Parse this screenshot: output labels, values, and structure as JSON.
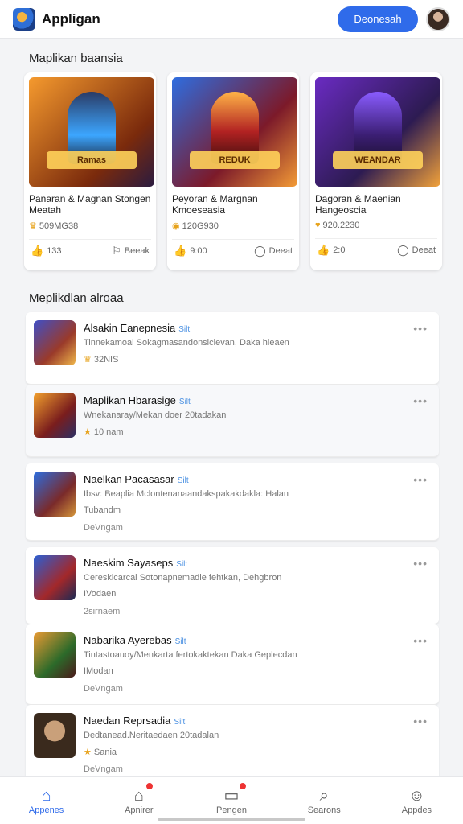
{
  "header": {
    "title": "Appligan",
    "button_label": "Deonesah",
    "logo_icon": "app-logo-icon",
    "avatar_icon": "user-avatar-icon"
  },
  "featured": {
    "title": "Maplikan baansia",
    "cards": [
      {
        "title": "Panaran & Magnan Stongen Meatah",
        "meta": "509MG38",
        "likes": "133",
        "action": "Beeak",
        "banner": "Ramas"
      },
      {
        "title": "Peyoran & Margnan Kmoeseasia",
        "meta": "120G930",
        "likes": "9:00",
        "action": "Deeat",
        "banner": "REDUK"
      },
      {
        "title": "Dagoran & Maenian Hangeoscia",
        "meta": "920.2230",
        "likes": "2:0",
        "action": "Deeat",
        "banner": "WEANDAR"
      }
    ]
  },
  "list": {
    "title": "Meplikdlan alroaa",
    "items": [
      {
        "name": "Alsakin Eanepnesia",
        "tag": "Silt",
        "desc": "Tinnekamoal Sokagmasandonsiclevan, Daka hleaen",
        "sub": "32NIS",
        "extra": ""
      },
      {
        "name": "Maplikan Hbarasige",
        "tag": "Silt",
        "desc": "Wnekanaray/Mekan doer 20tadakan",
        "sub": "10 nam",
        "extra": ""
      },
      {
        "name": "Naelkan Pacasasar",
        "tag": "Silt",
        "desc": "Ibsv: Beaplia Mclontenanaandakspakakdakla: Halan",
        "sub": "Tubandm",
        "extra": "DeVngam"
      },
      {
        "name": "Naeskim Sayaseps",
        "tag": "Silt",
        "desc": "Cereskicarcal Sotonapnemadle fehtkan, Dehgbron",
        "sub": "IVodaen",
        "extra": "2sirnaem"
      },
      {
        "name": "Nabarika Ayerebas",
        "tag": "Silt",
        "desc": "Tintastoauoy/Menkarta fertokaktekan Daka Geplecdan",
        "sub": "IModan",
        "extra": "DeVngam"
      },
      {
        "name": "Naedan Reprsadia",
        "tag": "Silt",
        "desc": "Dedtanead.Neritaedaen 20tadalan",
        "sub": "Sania",
        "extra": "DeVngam"
      }
    ]
  },
  "nav": {
    "items": [
      {
        "label": "Appenes",
        "icon": "home-icon"
      },
      {
        "label": "Apnirer",
        "icon": "notifications-icon"
      },
      {
        "label": "Pengen",
        "icon": "messages-icon"
      },
      {
        "label": "Searons",
        "icon": "search-icon"
      },
      {
        "label": "Appdes",
        "icon": "profile-icon"
      }
    ]
  },
  "colors": {
    "accent": "#2f6bea",
    "tag": "#4a90e2",
    "badge": "#e33333"
  }
}
